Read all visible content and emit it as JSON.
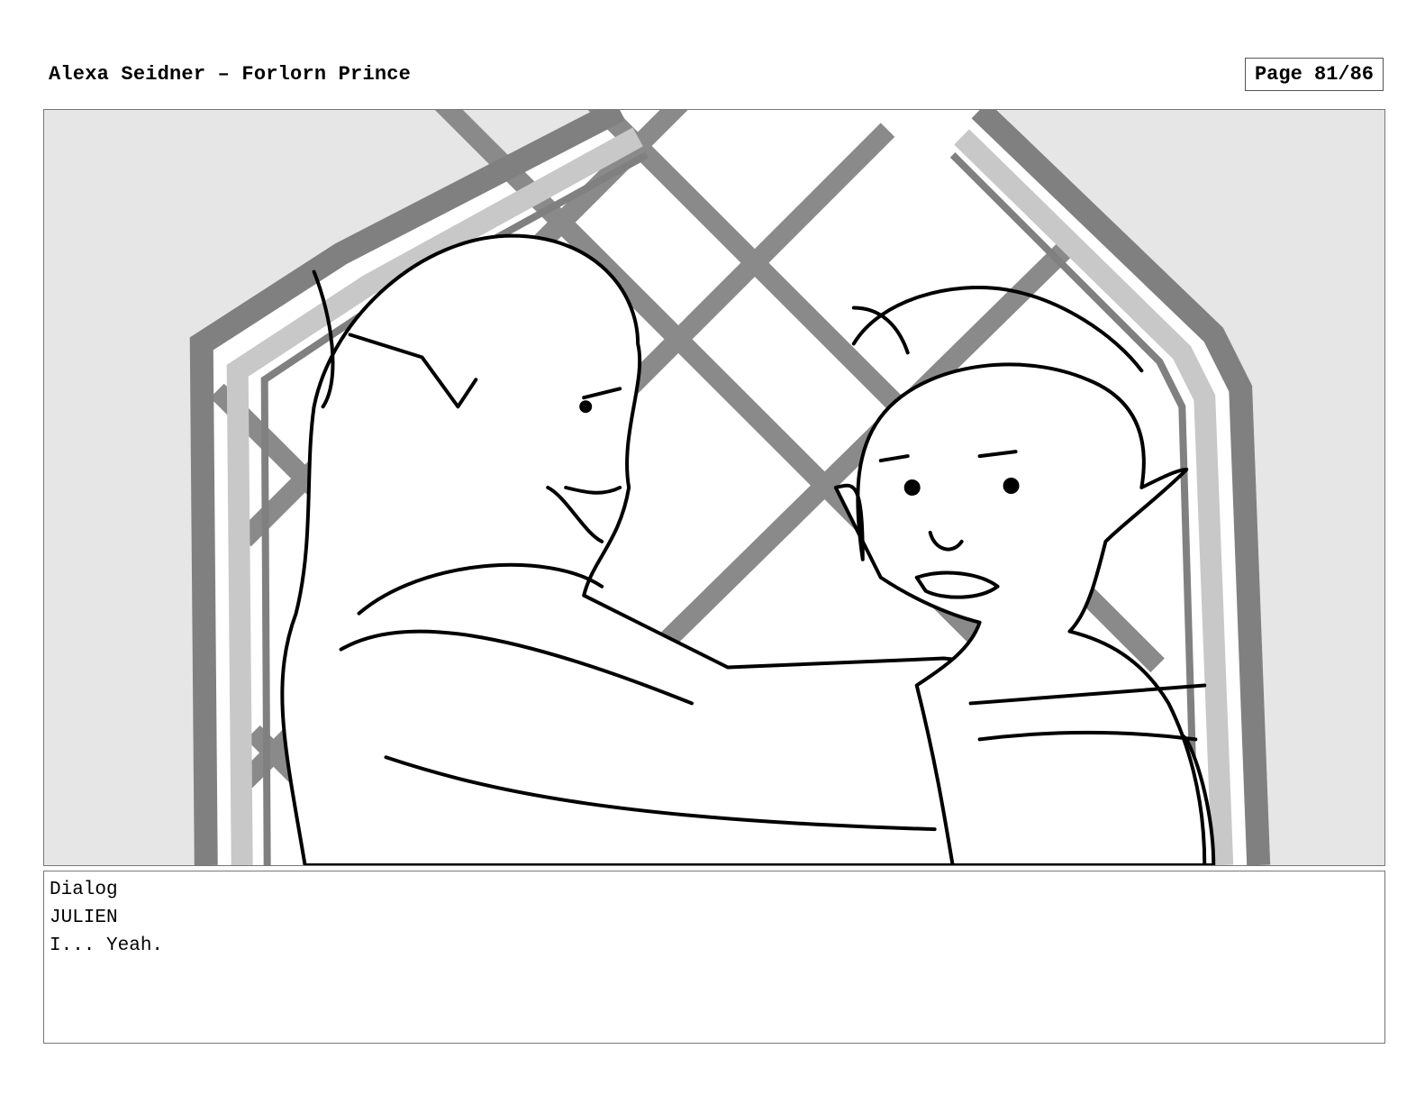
{
  "header": {
    "title": "Alexa Seidner – Forlorn Prince",
    "page_indicator": "Page 81/86"
  },
  "panel": {
    "image_kind": "storyboard-sketch",
    "colors": {
      "background": "#e6e6e6",
      "window_frame": "#808080",
      "window_frame_inner": "#c8c8c8",
      "window_light": "#ffffff",
      "ink": "#000000"
    }
  },
  "dialog": {
    "section_label": "Dialog",
    "speaker": "JULIEN",
    "line": "I... Yeah."
  }
}
